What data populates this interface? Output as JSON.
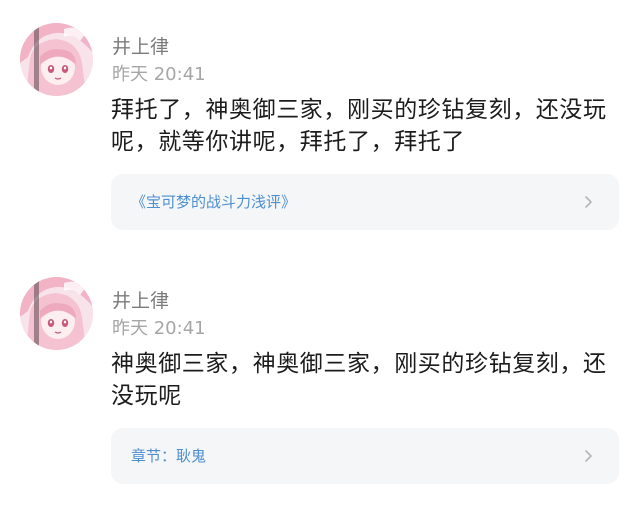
{
  "comments": [
    {
      "username": "井上律",
      "timestamp": "昨天 20:41",
      "content": "拜托了，神奥御三家，刚买的珍钻复刻，还没玩呢，就等你讲呢，拜托了，拜托了",
      "link": {
        "label": "《宝可梦的战斗力浅评》",
        "icon": "chevron-right-icon"
      }
    },
    {
      "username": "井上律",
      "timestamp": "昨天 20:41",
      "content": "神奥御三家，神奥御三家，刚买的珍钻复刻，还没玩呢",
      "link": {
        "label": "章节：耿鬼",
        "icon": "chevron-right-icon"
      }
    }
  ],
  "colors": {
    "username": "#7b7b7b",
    "timestamp": "#a6a6a6",
    "content": "#1c1c1c",
    "link": "#4d8fcf",
    "card_bg": "#f5f6f8"
  }
}
